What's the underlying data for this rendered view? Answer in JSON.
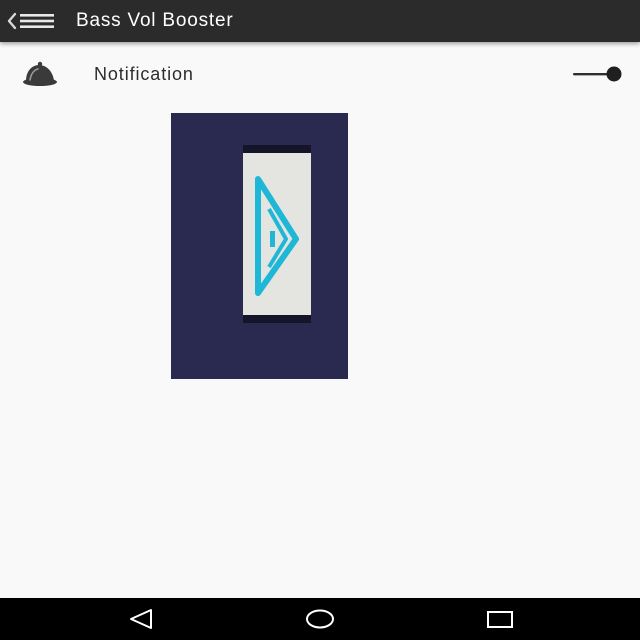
{
  "appbar": {
    "title": "Bass Vol Booster",
    "nav_icon": "back-menu-icon",
    "background": "#2b2b2b",
    "title_color": "#ffffff"
  },
  "settings": {
    "notification": {
      "label": "Notification",
      "icon": "bell-icon",
      "toggle_on": false
    }
  },
  "preview": {
    "background": "#2a2a50",
    "logo_icon": "bass-booster-logo-icon",
    "logo_color": "#1eb8d6"
  },
  "system_nav": {
    "back_icon": "triangle-back-icon",
    "home_icon": "circle-home-icon",
    "recents_icon": "square-recents-icon"
  }
}
